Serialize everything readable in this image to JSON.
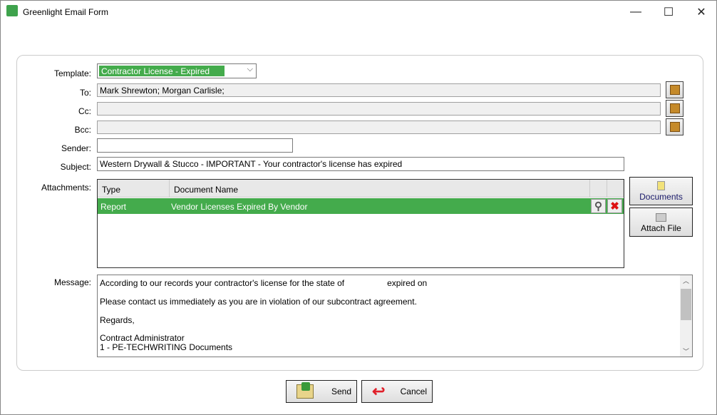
{
  "window": {
    "title": "Greenlight Email Form",
    "minimize": "—",
    "maximize": "☐",
    "close": "✕"
  },
  "form": {
    "template": {
      "label": "Template:",
      "value": "Contractor License - Expired"
    },
    "to": {
      "label": "To:",
      "value": "Mark Shrewton; Morgan Carlisle;"
    },
    "cc": {
      "label": "Cc:",
      "value": ""
    },
    "bcc": {
      "label": "Bcc:",
      "value": ""
    },
    "sender": {
      "label": "Sender:",
      "value": ""
    },
    "subject": {
      "label": "Subject:",
      "value": "Western Drywall & Stucco - IMPORTANT - Your contractor's license has expired"
    },
    "attachments": {
      "label": "Attachments:",
      "columns": [
        "Type",
        "Document Name"
      ],
      "rows": [
        {
          "type": "Report",
          "name": "Vendor Licenses Expired By Vendor"
        }
      ]
    },
    "message": {
      "label": "Message:",
      "lines": [
        "According to our records your contractor's license for the state of                  expired on",
        "Please contact us immediately as you are in violation of our subcontract agreement.",
        "Regards,",
        "Contract Administrator",
        "1 - PE-TECHWRITING Documents"
      ]
    }
  },
  "buttons": {
    "documents": "Documents",
    "attach_file": "Attach File",
    "send": "Send",
    "cancel": "Cancel"
  },
  "colors": {
    "accent": "#44ab4c"
  }
}
